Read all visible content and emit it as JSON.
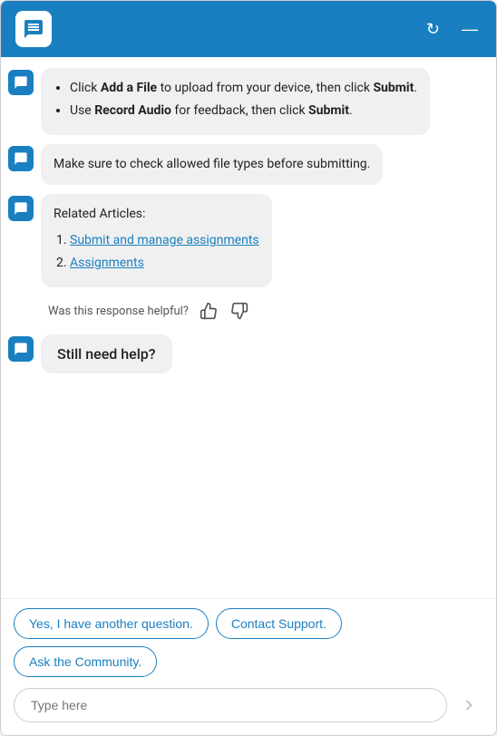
{
  "header": {
    "logo_alt": "Chat bot logo",
    "refresh_label": "↻",
    "minimize_label": "—"
  },
  "messages": [
    {
      "id": "msg1",
      "type": "bot",
      "html": "<ul><li>Click <strong>Add a File</strong> to upload from your device, then click <strong>Submit</strong>.</li><li>Use <strong>Record Audio</strong> for feedback, then click <strong>Submit</strong>.</li></ul>"
    },
    {
      "id": "msg2",
      "type": "bot",
      "html": "Make sure to check allowed file types before submitting."
    },
    {
      "id": "msg3",
      "type": "bot",
      "html": "<strong>Related Articles:</strong><br><br><ol><li><a href=\"#\">Submit and manage assignments</a></li><li><a href=\"#\">Assignments</a></li></ol>"
    }
  ],
  "helpful": {
    "label": "Was this response helpful?",
    "thumbsup": "👍",
    "thumbsdown": "👎"
  },
  "still_need": {
    "text": "Still need help?"
  },
  "quick_replies": [
    {
      "id": "qr1",
      "label": "Yes, I have another question."
    },
    {
      "id": "qr2",
      "label": "Contact Support."
    },
    {
      "id": "qr3",
      "label": "Ask the Community."
    }
  ],
  "input": {
    "placeholder": "Type here"
  },
  "send_icon": "➤"
}
